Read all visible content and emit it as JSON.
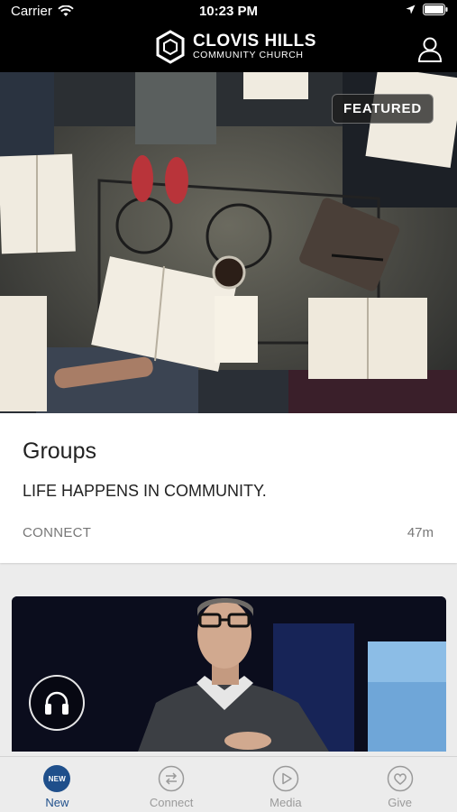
{
  "status_bar": {
    "carrier": "Carrier",
    "time": "10:23 PM"
  },
  "header": {
    "brand_name": "CLOVIS HILLS",
    "brand_sub": "COMMUNITY CHURCH"
  },
  "featured": {
    "badge": "FEATURED",
    "title": "Groups",
    "subtitle": "LIFE HAPPENS IN COMMUNITY.",
    "category": "CONNECT",
    "duration": "47m"
  },
  "tabs": [
    {
      "label": "New",
      "icon": "new-badge-icon",
      "badge": "NEW",
      "active": true
    },
    {
      "label": "Connect",
      "icon": "connect-icon",
      "active": false
    },
    {
      "label": "Media",
      "icon": "play-icon",
      "active": false
    },
    {
      "label": "Give",
      "icon": "heart-icon",
      "active": false
    }
  ],
  "colors": {
    "accent": "#1f4f8b",
    "header_bg": "#000000",
    "inactive": "#9a9a9a"
  }
}
